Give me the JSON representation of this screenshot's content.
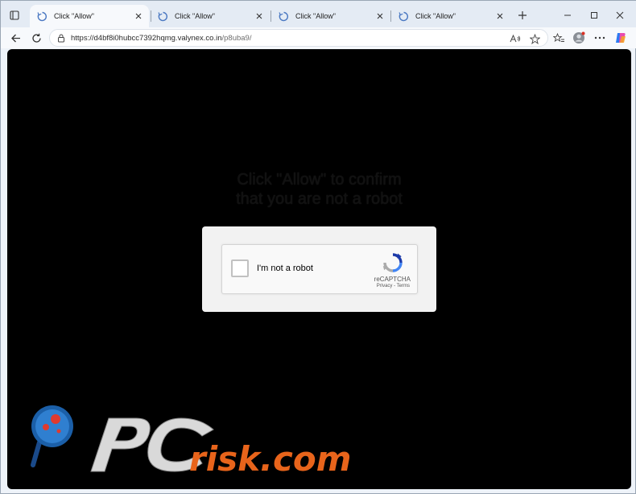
{
  "tabs": [
    {
      "title": "Click \"Allow\"",
      "active": true
    },
    {
      "title": "Click \"Allow\"",
      "active": false
    },
    {
      "title": "Click \"Allow\"",
      "active": false
    },
    {
      "title": "Click \"Allow\"",
      "active": false
    }
  ],
  "address": {
    "host": "https://d4bf8i0hubcc7392hqmg.valynex.co.in",
    "path": "/p8uba9/"
  },
  "page": {
    "headline_line1": "Click \"Allow\" to confirm",
    "headline_line2": "that you are not a robot"
  },
  "captcha": {
    "label": "I'm not a robot",
    "brand": "reCAPTCHA",
    "links": "Privacy - Terms",
    "checked": false
  },
  "watermark": {
    "text": "risk.com"
  },
  "colors": {
    "accent": "#1a73e8",
    "watermark": "#e8641b",
    "content_bg": "#000000"
  }
}
